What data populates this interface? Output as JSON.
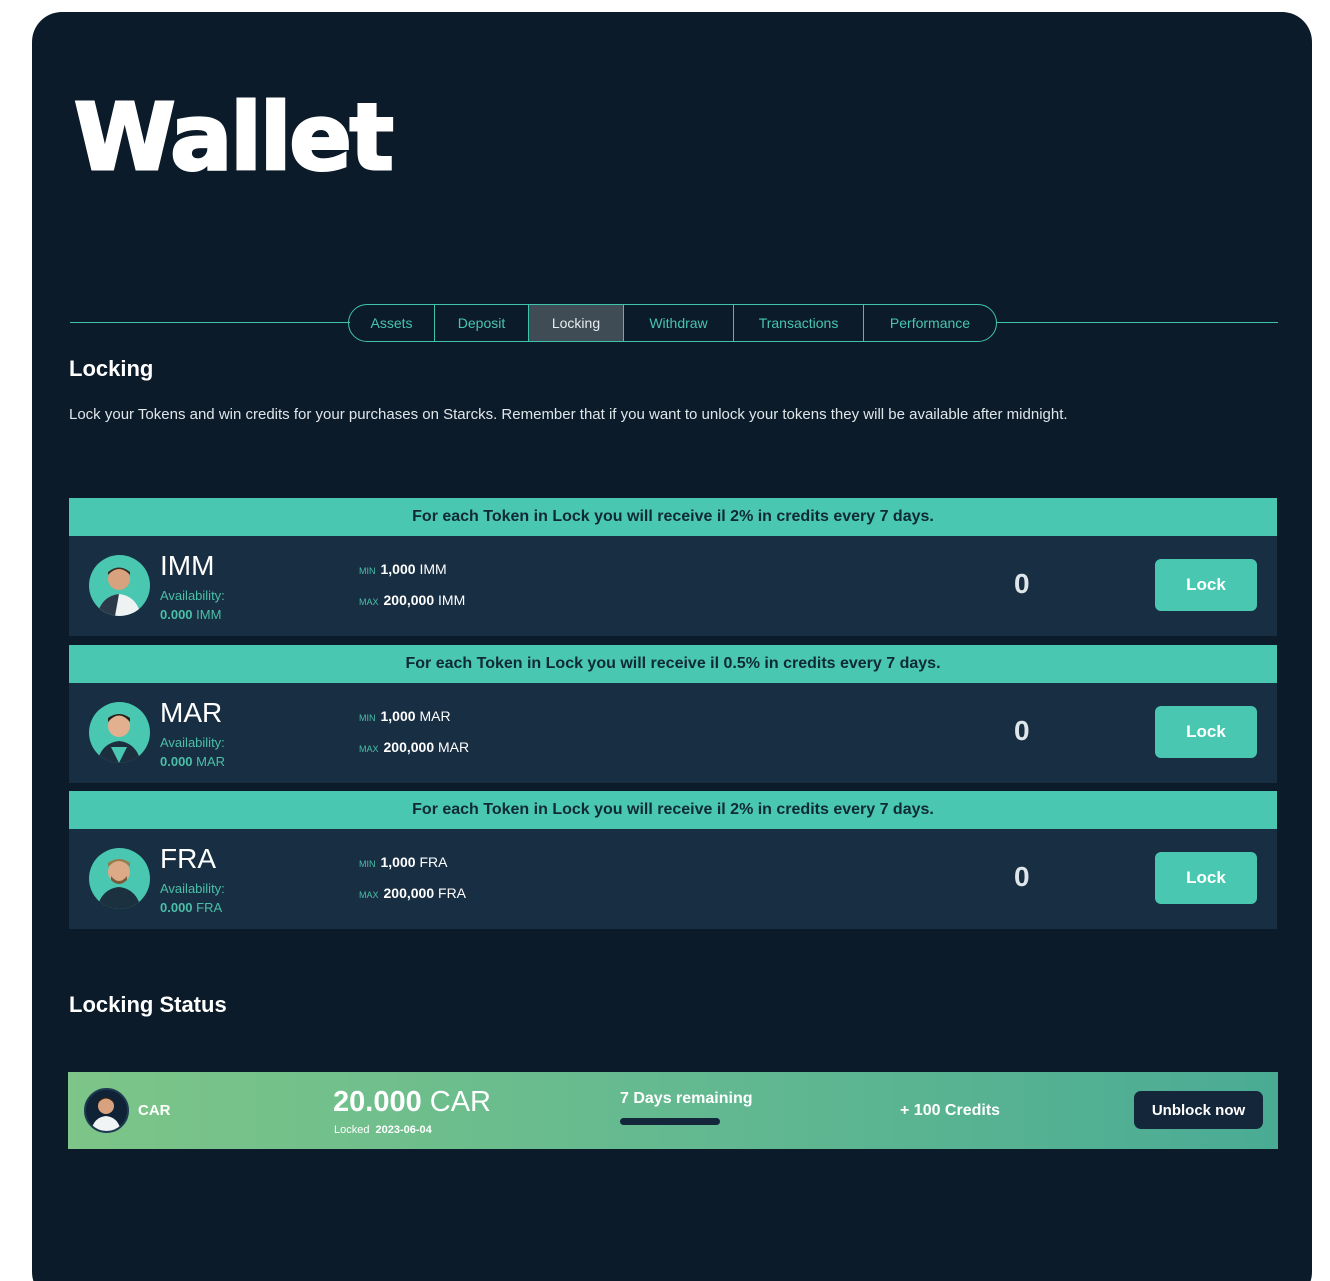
{
  "page": {
    "title": "Wallet"
  },
  "tabs": [
    {
      "label": "Assets"
    },
    {
      "label": "Deposit"
    },
    {
      "label": "Locking",
      "active": true
    },
    {
      "label": "Withdraw"
    },
    {
      "label": "Transactions"
    },
    {
      "label": "Performance"
    }
  ],
  "locking": {
    "title": "Locking",
    "description": "Lock your Tokens and win credits for your purchases on Starcks. Remember that if you want to unlock your tokens they will be available after midnight.",
    "tokens": [
      {
        "header": "For each Token in Lock you will receive il 2% in credits every 7 days.",
        "symbol": "IMM",
        "availability_label": "Availability:",
        "availability_value": "0.000",
        "availability_unit": "IMM",
        "min_tag": "MIN",
        "min_value": "1,000",
        "min_unit": "IMM",
        "max_tag": "MAX",
        "max_value": "200,000",
        "max_unit": "IMM",
        "amount": "0",
        "button": "Lock",
        "avatar_icon": "player-avatar-icon"
      },
      {
        "header": "For each Token in Lock you will receive il 0.5% in credits every 7 days.",
        "symbol": "MAR",
        "availability_label": "Availability:",
        "availability_value": "0.000",
        "availability_unit": "MAR",
        "min_tag": "MIN",
        "min_value": "1,000",
        "min_unit": "MAR",
        "max_tag": "MAX",
        "max_value": "200,000",
        "max_unit": "MAR",
        "amount": "0",
        "button": "Lock",
        "avatar_icon": "player-avatar-icon"
      },
      {
        "header": "For each Token in Lock you will receive il 2% in credits every 7 days.",
        "symbol": "FRA",
        "availability_label": "Availability:",
        "availability_value": "0.000",
        "availability_unit": "FRA",
        "min_tag": "MIN",
        "min_value": "1,000",
        "min_unit": "FRA",
        "max_tag": "MAX",
        "max_value": "200,000",
        "max_unit": "FRA",
        "amount": "0",
        "button": "Lock",
        "avatar_icon": "player-avatar-icon"
      }
    ]
  },
  "status": {
    "title": "Locking Status",
    "item": {
      "symbol": "CAR",
      "amount_value": "20.000",
      "amount_unit": "CAR",
      "locked_label": "Locked",
      "locked_date": "2023-06-04",
      "remaining": "7 Days remaining",
      "progress": 1.0,
      "credits": "+ 100  Credits",
      "button": "Unblock now",
      "avatar_icon": "player-avatar-icon"
    }
  },
  "colors": {
    "background": "#0c1b29",
    "accent": "#49c7b0",
    "card": "#182e42",
    "status_gradient_start": "#7dc588",
    "status_gradient_end": "#4aab94"
  }
}
